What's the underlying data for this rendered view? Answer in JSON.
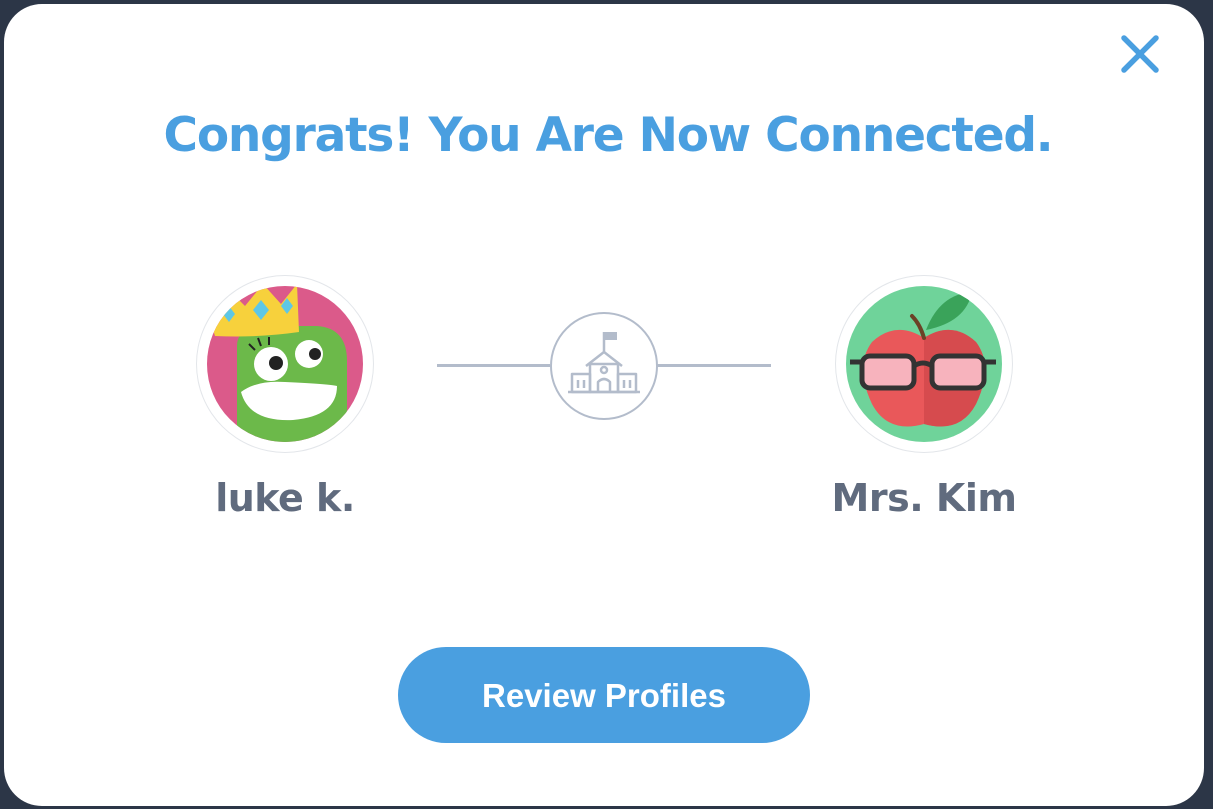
{
  "dialog": {
    "title": "Congrats! You Are Now Connected.",
    "close_icon": "close-icon",
    "accent_color": "#4a9fe0"
  },
  "connection": {
    "student": {
      "name": "luke k.",
      "avatar_icon": "monster-avatar-icon"
    },
    "teacher": {
      "name": "Mrs. Kim",
      "avatar_icon": "apple-with-glasses-avatar-icon"
    },
    "link_icon": "school-icon"
  },
  "actions": {
    "review_label": "Review Profiles"
  }
}
